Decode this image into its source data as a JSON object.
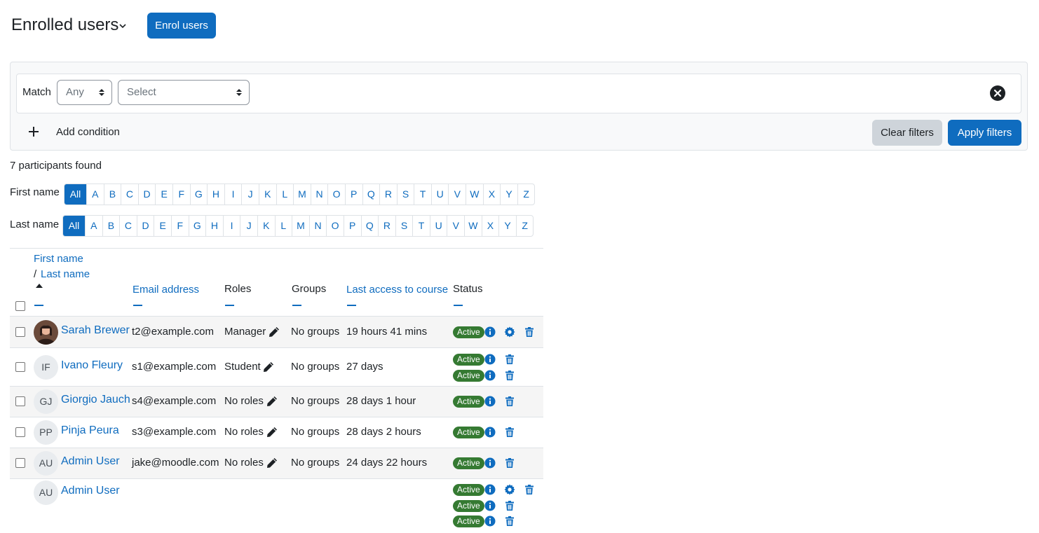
{
  "header": {
    "title": "Enrolled users",
    "enrol_button": "Enrol users"
  },
  "filter": {
    "match_label": "Match",
    "match_value": "Any",
    "field_value": "Select",
    "add_condition": "Add condition",
    "clear_filters": "Clear filters",
    "apply_filters": "Apply filters"
  },
  "participants_found": "7 participants found",
  "initials": {
    "first_label": "First name",
    "last_label": "Last name",
    "letters": [
      "All",
      "A",
      "B",
      "C",
      "D",
      "E",
      "F",
      "G",
      "H",
      "I",
      "J",
      "K",
      "L",
      "M",
      "N",
      "O",
      "P",
      "Q",
      "R",
      "S",
      "T",
      "U",
      "V",
      "W",
      "X",
      "Y",
      "Z"
    ]
  },
  "table": {
    "headers": {
      "first_name": "First name",
      "slash": "/",
      "last_name": "Last name",
      "email": "Email address",
      "roles": "Roles",
      "groups": "Groups",
      "last_access": "Last access to course",
      "status": "Status"
    },
    "rows": [
      {
        "name": "Sarah Brewer",
        "initials": "",
        "email": "t2@example.com",
        "roles": "Manager",
        "groups": "No groups",
        "last_access": "19 hours 41 mins",
        "statuses": [
          "Active"
        ]
      },
      {
        "name": "Ivano Fleury",
        "initials": "IF",
        "email": "s1@example.com",
        "roles": "Student",
        "groups": "No groups",
        "last_access": "27 days",
        "statuses": [
          "Active",
          "Active"
        ]
      },
      {
        "name": "Giorgio Jauch",
        "initials": "GJ",
        "email": "s4@example.com",
        "roles": "No roles",
        "groups": "No groups",
        "last_access": "28 days 1 hour",
        "statuses": [
          "Active"
        ]
      },
      {
        "name": "Pinja Peura",
        "initials": "PP",
        "email": "s3@example.com",
        "roles": "No roles",
        "groups": "No groups",
        "last_access": "28 days 2 hours",
        "statuses": [
          "Active"
        ]
      },
      {
        "name": "Admin User",
        "initials": "AU",
        "email": "jake@moodle.com",
        "roles": "No roles",
        "groups": "No groups",
        "last_access": "24 days 22 hours",
        "statuses": [
          "Active"
        ]
      },
      {
        "name": "Admin User",
        "initials": "AU",
        "email": "",
        "roles": "",
        "groups": "",
        "last_access": "",
        "statuses": [
          "Active",
          "Active",
          "Active"
        ]
      }
    ]
  },
  "colors": {
    "primary": "#0f6cbf",
    "success": "#357a32",
    "border": "#dee2e6"
  }
}
